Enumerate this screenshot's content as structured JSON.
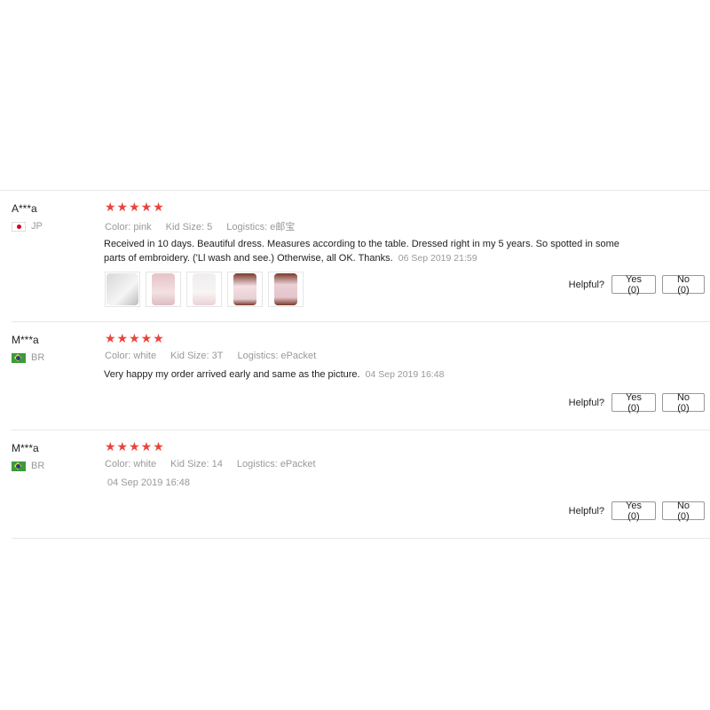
{
  "reviews": [
    {
      "user": "A***a",
      "country": "JP",
      "stars": "★★★★★",
      "color": "Color: pink",
      "size": "Kid Size: 5",
      "logistics": "Logistics: e邮宝",
      "text": "Received in 10 days. Beautiful dress. Measures according to the table. Dressed right in my 5 years. So spotted in some parts of embroidery. ('Ll wash and see.) Otherwise, all OK. Thanks.",
      "date": "06 Sep 2019 21:59",
      "helpful_label": "Helpful?",
      "yes_label": "Yes (0)",
      "no_label": "No (0)"
    },
    {
      "user": "M***a",
      "country": "BR",
      "stars": "★★★★★",
      "color": "Color: white",
      "size": "Kid Size: 3T",
      "logistics": "Logistics: ePacket",
      "text": "Very happy my order arrived early and same as the picture.",
      "date": "04 Sep 2019 16:48",
      "helpful_label": "Helpful?",
      "yes_label": "Yes (0)",
      "no_label": "No (0)"
    },
    {
      "user": "M***a",
      "country": "BR",
      "stars": "★★★★★",
      "color": "Color: white",
      "size": "Kid Size: 14",
      "logistics": "Logistics: ePacket",
      "date": "04 Sep 2019 16:48",
      "helpful_label": "Helpful?",
      "yes_label": "Yes (0)",
      "no_label": "No (0)"
    }
  ],
  "icons": {
    "star": "star-icon",
    "flag_jp": "japan-flag-icon",
    "flag_br": "brazil-flag-icon"
  },
  "colors": {
    "star": "#e8453c",
    "meta_text": "#999999",
    "divider": "#e8e8e8"
  }
}
